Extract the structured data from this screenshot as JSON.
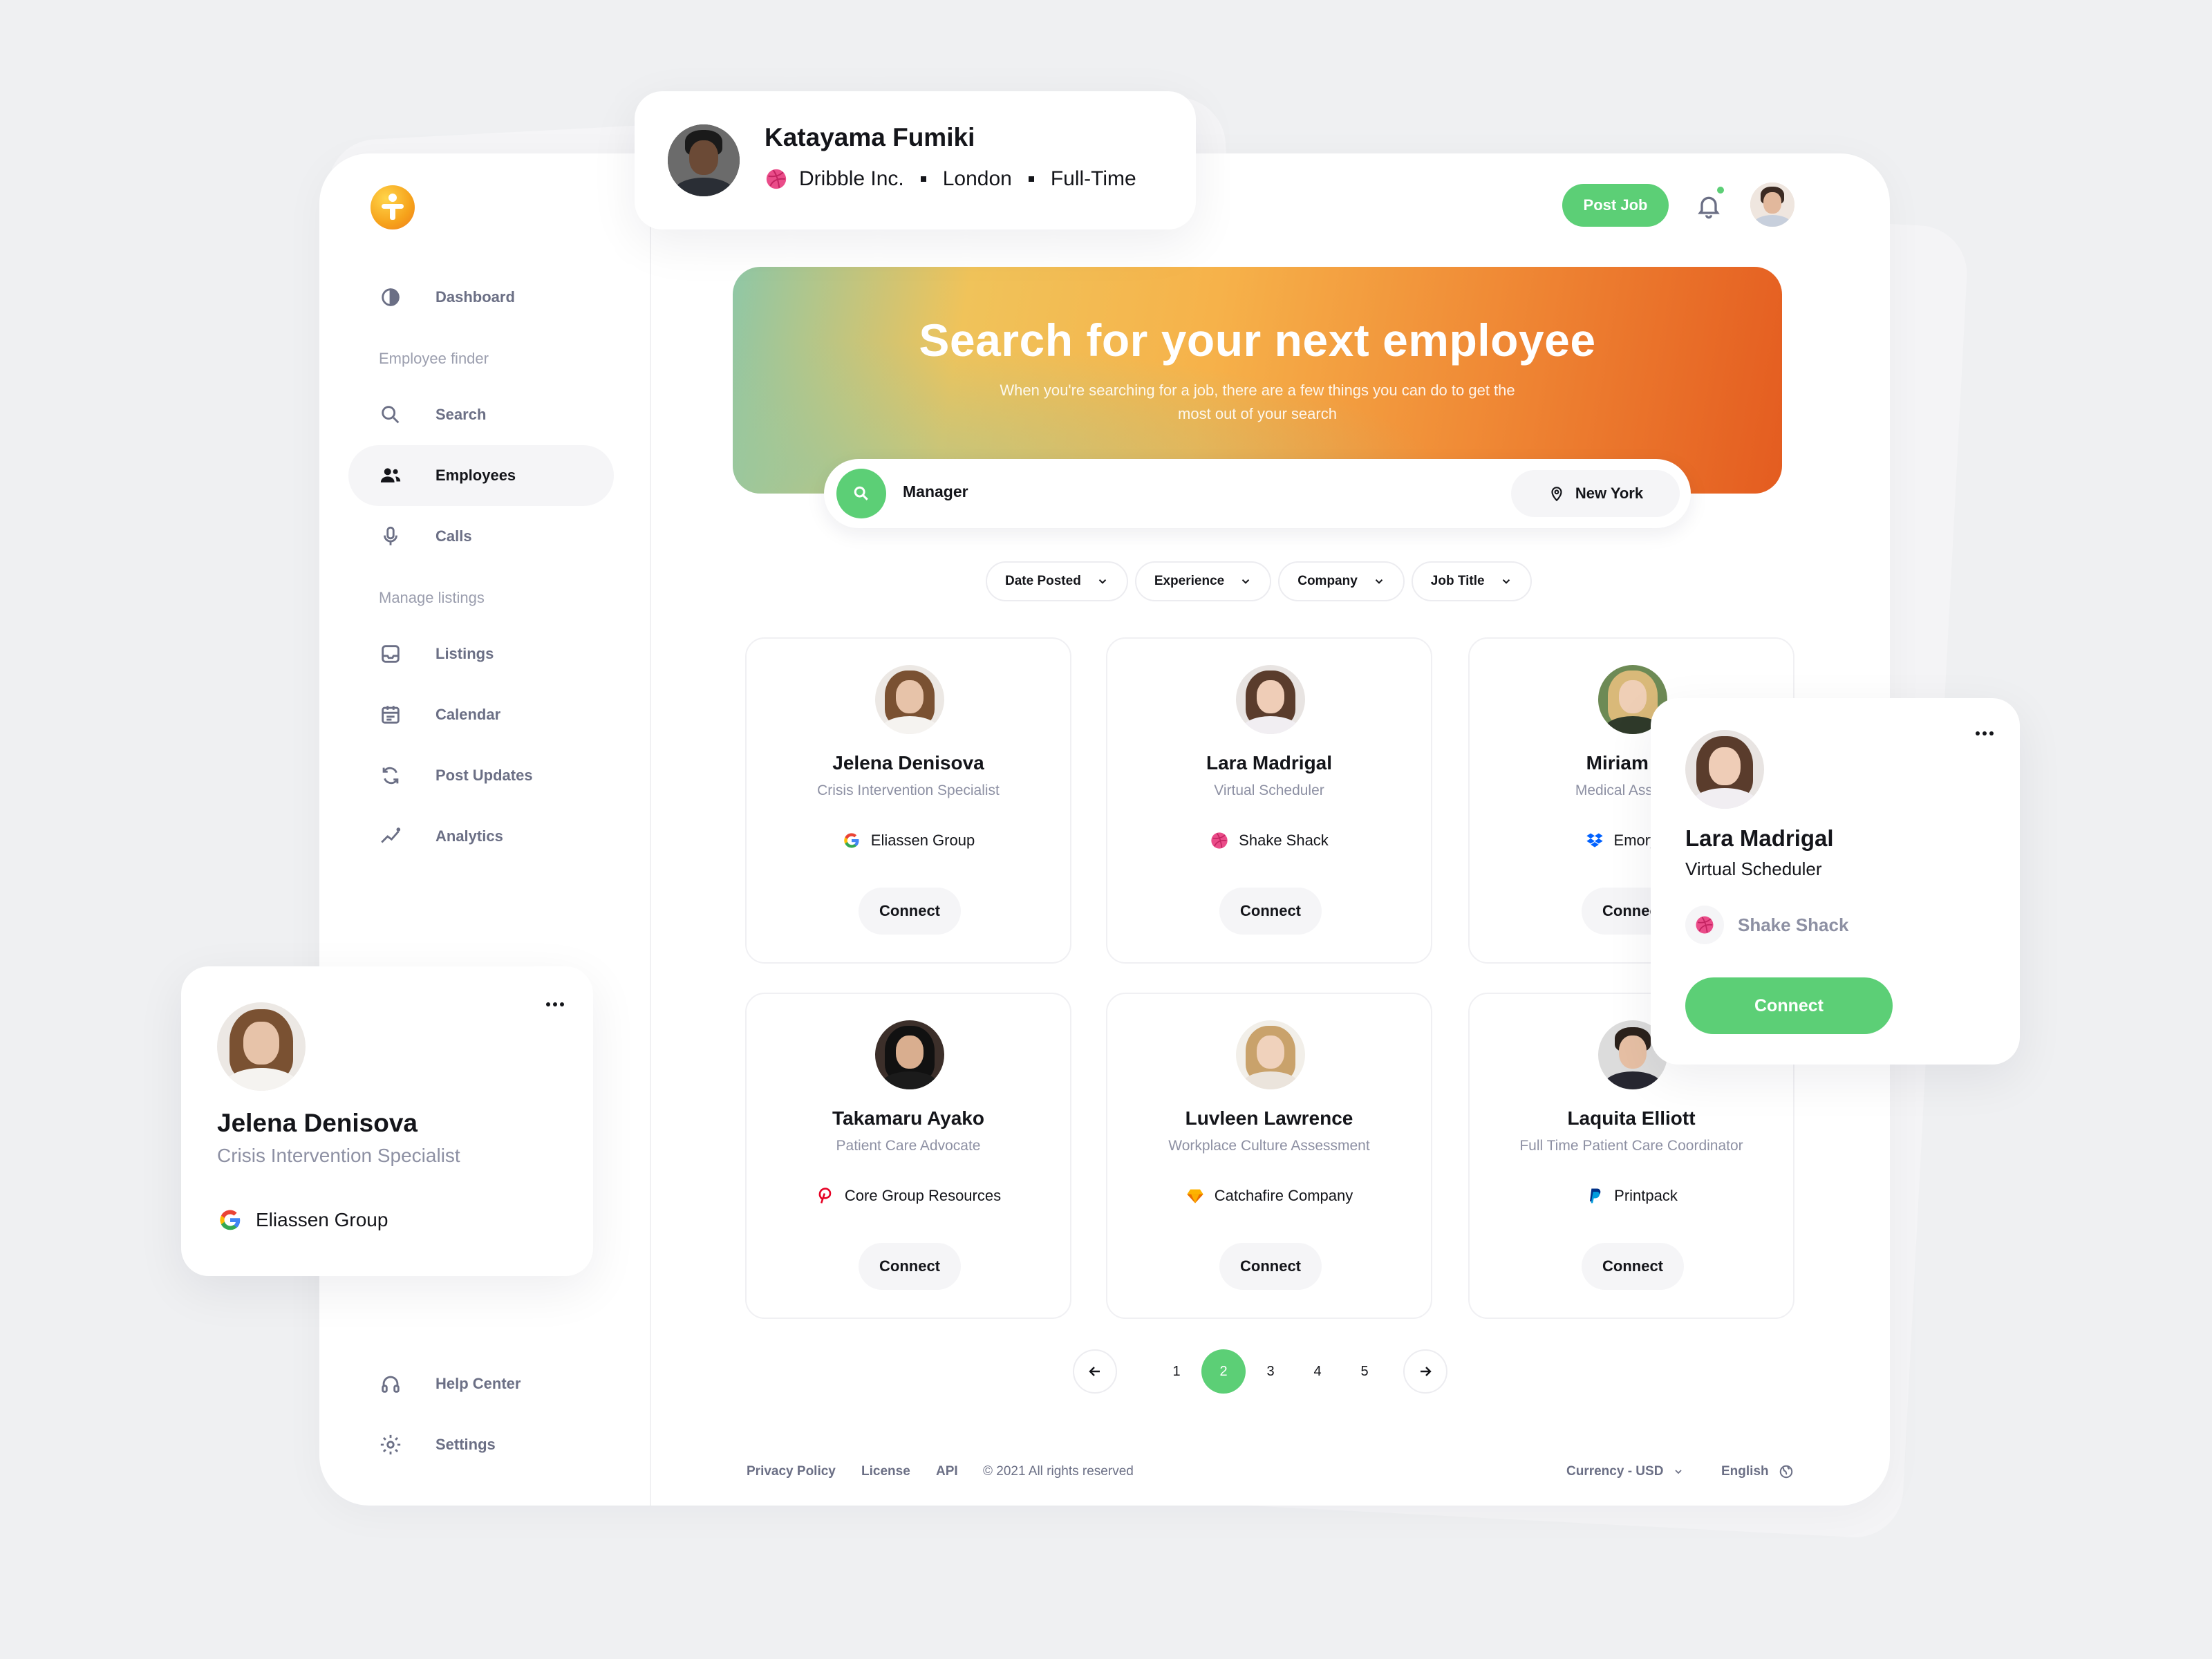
{
  "sidebar": {
    "items": [
      {
        "label": "Dashboard"
      },
      {
        "label": "Search"
      },
      {
        "label": "Employees"
      },
      {
        "label": "Calls"
      },
      {
        "label": "Listings"
      },
      {
        "label": "Calendar"
      },
      {
        "label": "Post Updates"
      },
      {
        "label": "Analytics"
      },
      {
        "label": "Help Center"
      },
      {
        "label": "Settings"
      }
    ],
    "sections": [
      "Employee finder",
      "Manage listings"
    ],
    "active": "Employees"
  },
  "header": {
    "post_job_label": "Post Job"
  },
  "hero": {
    "title": "Search for your next employee",
    "subtitle": "When you're searching for a job, there are a few things you can do to get the most out of your search"
  },
  "search": {
    "value": "Manager",
    "location": "New York"
  },
  "filters": [
    "Date Posted",
    "Experience",
    "Company",
    "Job Title"
  ],
  "cards": [
    {
      "name": "Jelena Denisova",
      "role": "Crisis Intervention Specialist",
      "company": "Eliassen Group",
      "connect": "Connect"
    },
    {
      "name": "Lara Madrigal",
      "role": "Virtual Scheduler",
      "company": "Shake Shack",
      "connect": "Connect"
    },
    {
      "name": "Miriam Jo",
      "role": "Medical Assistant",
      "company": "Emory Ur",
      "connect": "Connect"
    },
    {
      "name": "Takamaru Ayako",
      "role": "Patient Care Advocate",
      "company": "Core Group Resources",
      "connect": "Connect"
    },
    {
      "name": "Luvleen Lawrence",
      "role": "Workplace Culture Assessment",
      "company": "Catchafire Company",
      "connect": "Connect"
    },
    {
      "name": "Laquita Elliott",
      "role": "Full Time Patient Care Coordinator",
      "company": "Printpack",
      "connect": "Connect"
    }
  ],
  "pagination": {
    "pages": [
      "1",
      "2",
      "3",
      "4",
      "5"
    ],
    "current": "2"
  },
  "footer": {
    "links": [
      "Privacy Policy",
      "License",
      "API"
    ],
    "copyright": "© 2021 All rights reserved",
    "currency": "Currency - USD",
    "language": "English"
  },
  "float_top": {
    "name": "Katayama Fumiki",
    "company": "Dribble Inc.",
    "city": "London",
    "type": "Full-Time"
  },
  "float_left": {
    "name": "Jelena Denisova",
    "role": "Crisis Intervention Specialist",
    "company": "Eliassen Group"
  },
  "float_right": {
    "name": "Lara Madrigal",
    "role": "Virtual Scheduler",
    "company": "Shake Shack",
    "connect": "Connect"
  },
  "colors": {
    "accent": "#5ccf76",
    "dribbble": "#ea4c89",
    "text": "#14151a",
    "muted": "#8d90a3"
  }
}
